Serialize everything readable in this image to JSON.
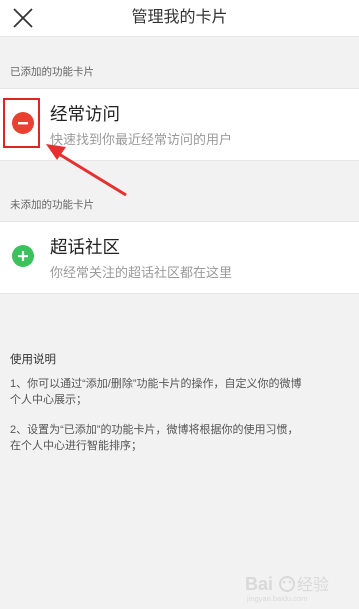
{
  "header": {
    "title": "管理我的卡片",
    "close_icon": "close-icon"
  },
  "added_section": {
    "label": "已添加的功能卡片",
    "card": {
      "title": "经常访问",
      "subtitle": "快速找到你最近经常访问的用户",
      "action_icon": "minus-circle-icon",
      "action_color": "#e8412f",
      "highlight_color": "#e02424"
    }
  },
  "unadded_section": {
    "label": "未添加的功能卡片",
    "card": {
      "title": "超话社区",
      "subtitle": "你经常关注的超话社区都在这里",
      "action_icon": "plus-circle-icon",
      "action_color": "#3cc15c"
    }
  },
  "instructions": {
    "title": "使用说明",
    "items": [
      {
        "line1": "1、你可以通过“添加/删除”功能卡片的操作，自定义你的微博",
        "line2": "个人中心展示；"
      },
      {
        "line1": "2、设置为“已添加”的功能卡片，微博将根据你的使用习惯，",
        "line2": "在个人中心进行智能排序；"
      }
    ]
  },
  "watermark": {
    "text": "Bai经验",
    "sub": "jingyan.baidu.com"
  }
}
